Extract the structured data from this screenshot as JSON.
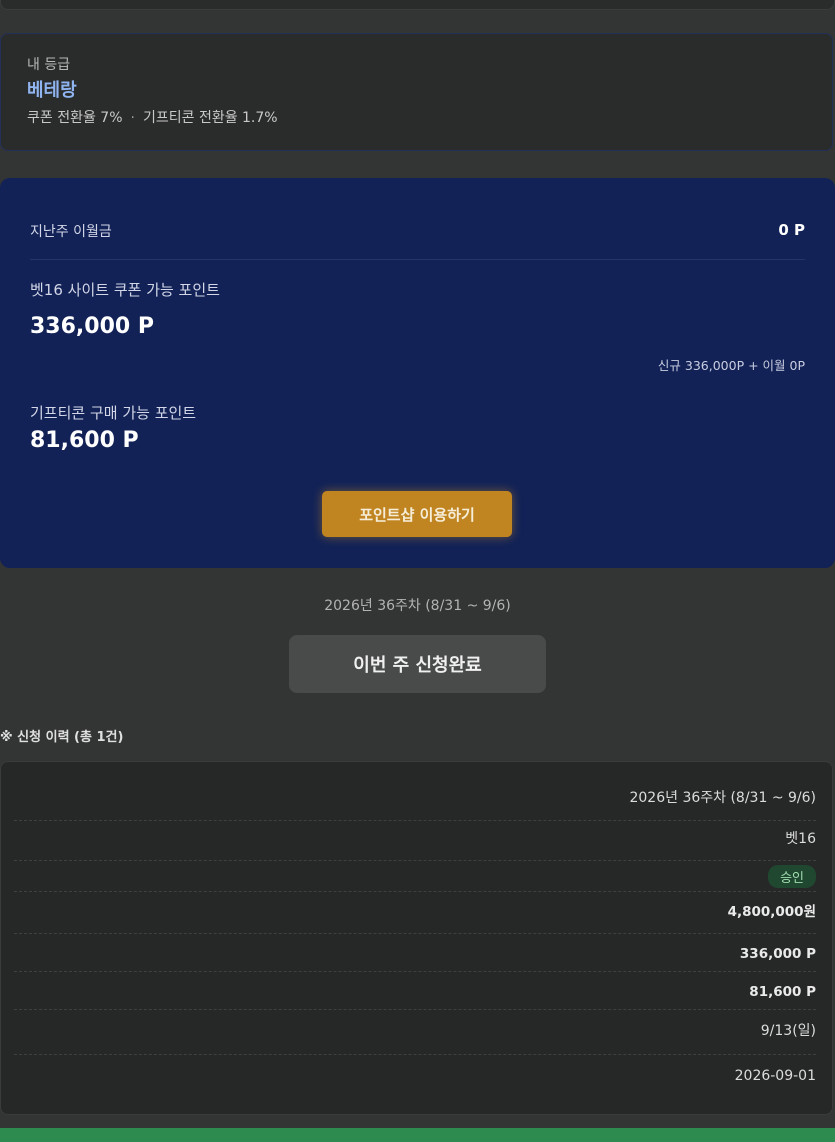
{
  "grade": {
    "label": "내 등급",
    "name": "베테랑",
    "coupon_rate": "쿠폰 전환율 7%",
    "separator": "·",
    "gifticon_rate": "기프티콘 전환율 1.7%"
  },
  "points": {
    "last_week_label": "지난주 이월금",
    "last_week_value": "0 P",
    "coupon_label": "벳16 사이트 쿠폰 가능 포인트",
    "coupon_value": "336,000 P",
    "coupon_detail": "신규 336,000P + 이월 0P",
    "gifticon_label": "기프티콘 구매 가능 포인트",
    "gifticon_value": "81,600 P",
    "shop_button": "포인트샵 이용하기"
  },
  "week": {
    "label": "2026년 36주차 (8/31 ~ 9/6)",
    "apply_done": "이번 주 신청완료"
  },
  "history": {
    "title": "※ 신청 이력 (총 1건)",
    "rows": {
      "week": "2026년 36주차 (8/31 ~ 9/6)",
      "site": "벳16",
      "status": "승인",
      "amount": "4,800,000원",
      "coupon_points": "336,000 P",
      "gifticon_points": "81,600 P",
      "pay_date": "9/13(일)",
      "apply_date": "2026-09-01"
    }
  },
  "colors": {
    "background": "#333434",
    "points_card": "#122257",
    "shop_button": "#c08521",
    "grade_name": "#8fb4f0",
    "status_badge": "#20472f",
    "bottom_bar": "#2e8b4f"
  }
}
